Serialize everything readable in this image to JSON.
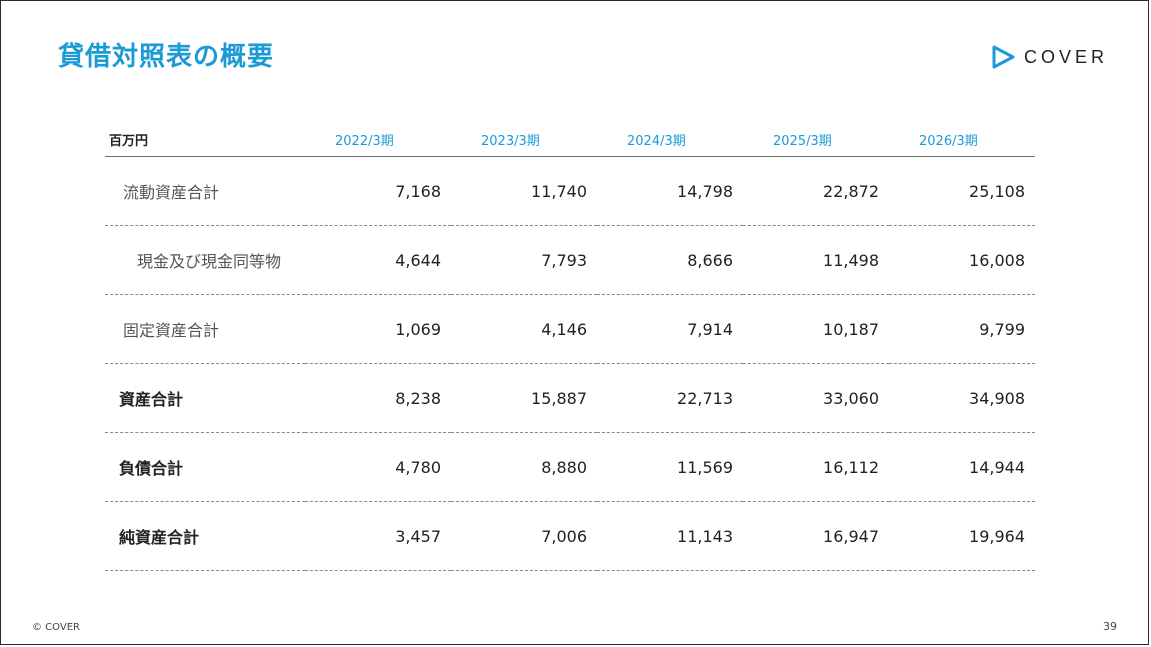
{
  "slide": {
    "title": "貸借対照表の概要",
    "brand": "COVER",
    "accent_color": "#1a9ad6",
    "footer": "© COVER",
    "page_number": "39"
  },
  "table": {
    "unit": "百万円",
    "periods": [
      "2022/3期",
      "2023/3期",
      "2024/3期",
      "2025/3期",
      "2026/3期"
    ],
    "rows": [
      {
        "label": "流動資産合計",
        "values": [
          "7,168",
          "11,740",
          "14,798",
          "22,872",
          "25,108"
        ]
      },
      {
        "label": "現金及び現金同等物",
        "values": [
          "4,644",
          "7,793",
          "8,666",
          "11,498",
          "16,008"
        ]
      },
      {
        "label": "固定資産合計",
        "values": [
          "1,069",
          "4,146",
          "7,914",
          "10,187",
          "9,799"
        ]
      },
      {
        "label": "資産合計",
        "values": [
          "8,238",
          "15,887",
          "22,713",
          "33,060",
          "34,908"
        ]
      },
      {
        "label": "負債合計",
        "values": [
          "4,780",
          "8,880",
          "11,569",
          "16,112",
          "14,944"
        ]
      },
      {
        "label": "純資産合計",
        "values": [
          "3,457",
          "7,006",
          "11,143",
          "16,947",
          "19,964"
        ]
      }
    ]
  }
}
